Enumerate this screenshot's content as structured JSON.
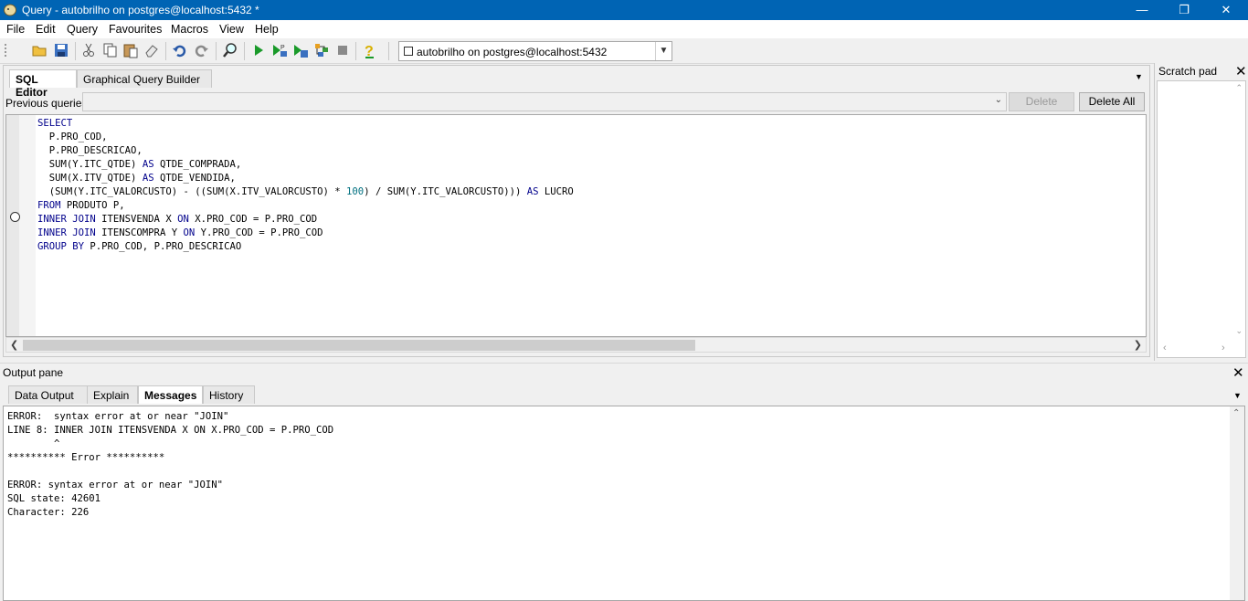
{
  "window": {
    "title": "Query - autobrilho on postgres@localhost:5432 *"
  },
  "menu": [
    "File",
    "Edit",
    "Query",
    "Favourites",
    "Macros",
    "View",
    "Help"
  ],
  "toolbar": {
    "connection": "autobrilho on postgres@localhost:5432"
  },
  "editor": {
    "tabs": [
      "SQL Editor",
      "Graphical Query Builder"
    ],
    "previous_queries_label": "Previous queries",
    "delete_label": "Delete",
    "delete_all_label": "Delete All"
  },
  "sql": {
    "l1": "SELECT",
    "l2": "  P.PRO_COD,",
    "l3": "  P.PRO_DESCRICAO,",
    "l4a": "  SUM(Y.ITC_QTDE) ",
    "l4kw": "AS",
    "l4b": " QTDE_COMPRADA,",
    "l5a": "  SUM(X.ITV_QTDE) ",
    "l5kw": "AS",
    "l5b": " QTDE_VENDIDA,",
    "l6a": "  (SUM(Y.ITC_VALORCUSTO) - ((SUM(X.ITV_VALORCUSTO) * ",
    "l6num": "100",
    "l6b": ") / SUM(Y.ITC_VALORCUSTO))) ",
    "l6kw": "AS",
    "l6c": " LUCRO",
    "l7kw": "FROM",
    "l7": " PRODUTO P,",
    "l8kw": "INNER JOIN",
    "l8a": " ITENSVENDA X ",
    "l8kw2": "ON",
    "l8b": " X.PRO_COD = P.PRO_COD",
    "l9kw": "INNER JOIN",
    "l9a": " ITENSCOMPRA Y ",
    "l9kw2": "ON",
    "l9b": " Y.PRO_COD = P.PRO_COD",
    "l10kw": "GROUP BY",
    "l10": " P.PRO_COD, P.PRO_DESCRICAO"
  },
  "scratchpad": {
    "label": "Scratch pad"
  },
  "output": {
    "label": "Output pane",
    "tabs": [
      "Data Output",
      "Explain",
      "Messages",
      "History"
    ],
    "messages": "ERROR:  syntax error at or near \"JOIN\"\nLINE 8: INNER JOIN ITENSVENDA X ON X.PRO_COD = P.PRO_COD\n        ^\n********** Error **********\n\nERROR: syntax error at or near \"JOIN\"\nSQL state: 42601\nCharacter: 226"
  }
}
